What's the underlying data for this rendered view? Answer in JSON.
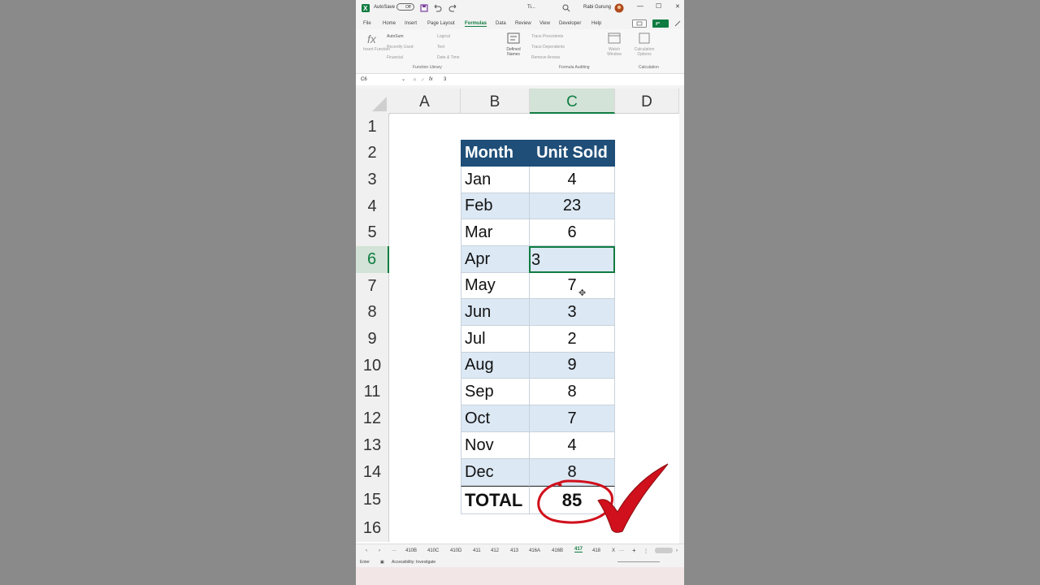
{
  "titlebar": {
    "autosave": "AutoSave",
    "autosave_state": "Off",
    "doc_title": "Ti...",
    "user": "Rabi Gurung",
    "min": "—",
    "max": "☐",
    "close": "✕"
  },
  "menu": [
    "File",
    "Home",
    "Insert",
    "Page Layout",
    "Formulas",
    "Data",
    "Review",
    "View",
    "Developer",
    "Help"
  ],
  "ribbon": {
    "insert_function": "Insert Function",
    "autosum": "AutoSum",
    "recently_used": "Recently Used",
    "financial": "Financial",
    "logical": "Logical",
    "text": "Text",
    "date_time": "Date & Time",
    "defined_names": "Defined Names",
    "trace_precedents": "Trace Precedents",
    "trace_dependents": "Trace Dependents",
    "remove_arrows": "Remove Arrows",
    "watch_window": "Watch Window",
    "calculation_options": "Calculation Options",
    "group_function_library": "Function Library",
    "group_formula_auditing": "Formula Auditing",
    "group_calculation": "Calculation"
  },
  "formula_bar": {
    "name_box": "C6",
    "fx": "fx",
    "value": "3"
  },
  "columns": [
    "A",
    "B",
    "C",
    "D"
  ],
  "rows": [
    "1",
    "2",
    "3",
    "4",
    "5",
    "6",
    "7",
    "8",
    "9",
    "10",
    "11",
    "12",
    "13",
    "14",
    "15",
    "16"
  ],
  "table": {
    "header_month": "Month",
    "header_units": "Unit Sold",
    "records": [
      {
        "month": "Jan",
        "units": "4"
      },
      {
        "month": "Feb",
        "units": "23"
      },
      {
        "month": "Mar",
        "units": "6"
      },
      {
        "month": "Apr",
        "units": "3"
      },
      {
        "month": "May",
        "units": "7"
      },
      {
        "month": "Jun",
        "units": "3"
      },
      {
        "month": "Jul",
        "units": "2"
      },
      {
        "month": "Aug",
        "units": "9"
      },
      {
        "month": "Sep",
        "units": "8"
      },
      {
        "month": "Oct",
        "units": "7"
      },
      {
        "month": "Nov",
        "units": "4"
      },
      {
        "month": "Dec",
        "units": "8"
      }
    ],
    "total_label": "TOTAL",
    "total_value": "85"
  },
  "active_cell_input": "3",
  "sheet_tabs": [
    "410B",
    "410C",
    "410D",
    "411",
    "412",
    "413",
    "416A",
    "416B",
    "417",
    "418",
    "X"
  ],
  "active_sheet": "417",
  "status": {
    "mode": "Enter",
    "accessibility": "Accessibility: Investigate"
  },
  "colors": {
    "excel_green": "#107c41",
    "header_blue": "#1f4e78",
    "band_blue": "#dce8f4",
    "annotation_red": "#d0101c"
  }
}
